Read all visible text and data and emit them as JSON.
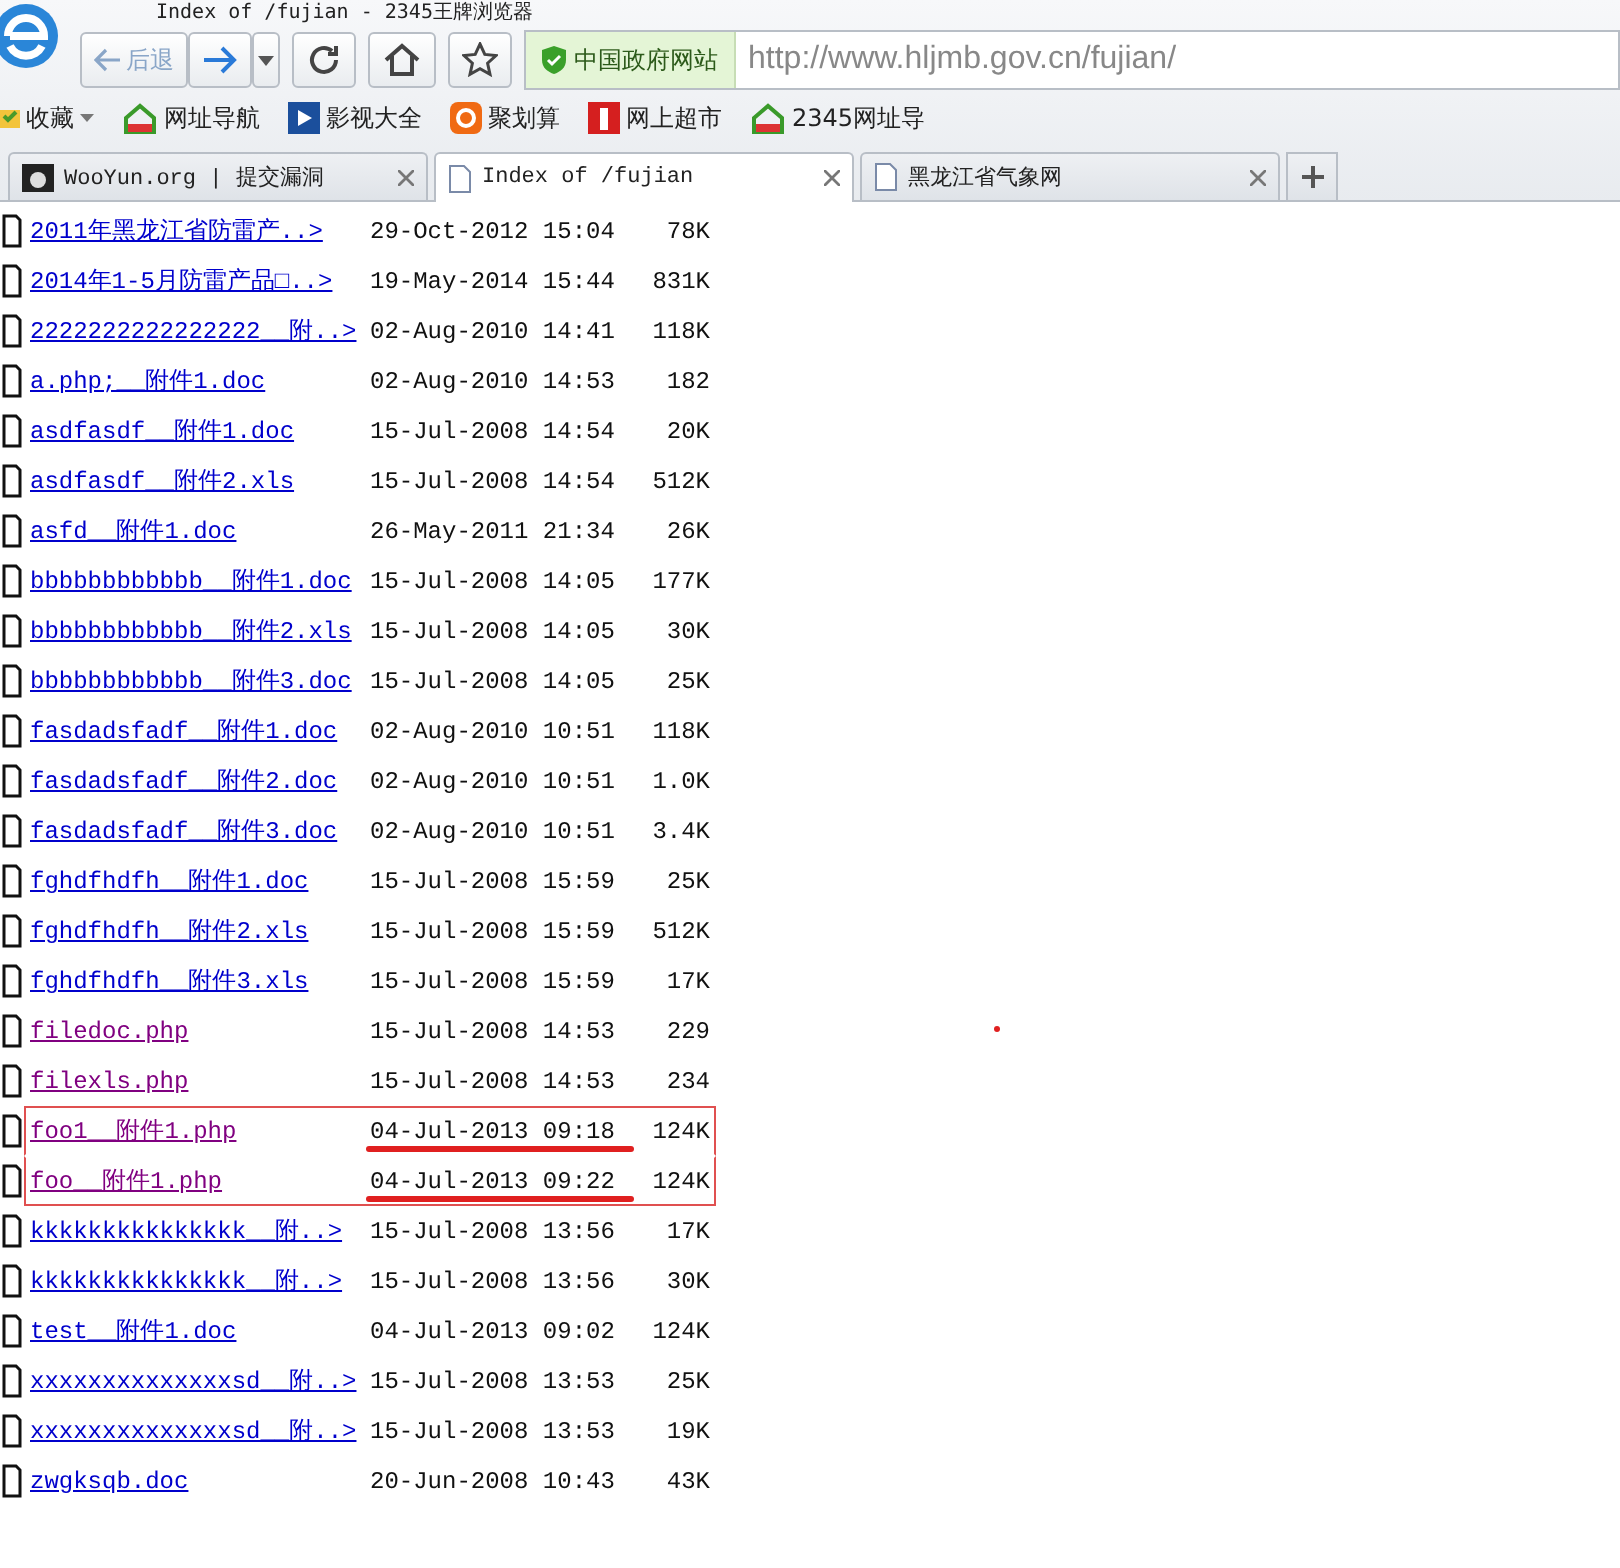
{
  "window": {
    "title": "Index of /fujian - 2345王牌浏览器"
  },
  "toolbar": {
    "back_label": "后退",
    "security_badge": "中国政府网站",
    "url": "http://www.hljmb.gov.cn/fujian/"
  },
  "bookmarks": [
    {
      "label": "收藏",
      "kind": "favorites"
    },
    {
      "label": "网址导航",
      "kind": "nav"
    },
    {
      "label": "影视大全",
      "kind": "video"
    },
    {
      "label": "聚划算",
      "kind": "deal"
    },
    {
      "label": "网上超市",
      "kind": "shop"
    },
    {
      "label": "2345网址导",
      "kind": "nav"
    }
  ],
  "tabs": [
    {
      "label": "WooYun.org | 提交漏洞",
      "selected": false,
      "kind": "site"
    },
    {
      "label": "Index of /fujian",
      "selected": true,
      "kind": "page"
    },
    {
      "label": "黑龙江省气象网",
      "selected": false,
      "kind": "page"
    }
  ],
  "listing": [
    {
      "name": "2011年黑龙江省防雷产..>",
      "date": "29-Oct-2012 15:04",
      "size": "78K",
      "visited": false,
      "highlighted": false,
      "underlined": false
    },
    {
      "name": "2014年1-5月防雷产品□..>",
      "date": "19-May-2014 15:44",
      "size": "831K",
      "visited": false,
      "highlighted": false,
      "underlined": false
    },
    {
      "name": "2222222222222222__附..>",
      "date": "02-Aug-2010 14:41",
      "size": "118K",
      "visited": false,
      "highlighted": false,
      "underlined": false
    },
    {
      "name": "a.php;__附件1.doc",
      "date": "02-Aug-2010 14:53",
      "size": "182",
      "visited": false,
      "highlighted": false,
      "underlined": false
    },
    {
      "name": "asdfasdf__附件1.doc",
      "date": "15-Jul-2008 14:54",
      "size": "20K",
      "visited": false,
      "highlighted": false,
      "underlined": false
    },
    {
      "name": "asdfasdf__附件2.xls",
      "date": "15-Jul-2008 14:54",
      "size": "512K",
      "visited": false,
      "highlighted": false,
      "underlined": false
    },
    {
      "name": "asfd__附件1.doc",
      "date": "26-May-2011 21:34",
      "size": "26K",
      "visited": false,
      "highlighted": false,
      "underlined": false
    },
    {
      "name": "bbbbbbbbbbbb__附件1.doc",
      "date": "15-Jul-2008 14:05",
      "size": "177K",
      "visited": false,
      "highlighted": false,
      "underlined": false
    },
    {
      "name": "bbbbbbbbbbbb__附件2.xls",
      "date": "15-Jul-2008 14:05",
      "size": "30K",
      "visited": false,
      "highlighted": false,
      "underlined": false
    },
    {
      "name": "bbbbbbbbbbbb__附件3.doc",
      "date": "15-Jul-2008 14:05",
      "size": "25K",
      "visited": false,
      "highlighted": false,
      "underlined": false
    },
    {
      "name": "fasdadsfadf__附件1.doc",
      "date": "02-Aug-2010 10:51",
      "size": "118K",
      "visited": false,
      "highlighted": false,
      "underlined": false
    },
    {
      "name": "fasdadsfadf__附件2.doc",
      "date": "02-Aug-2010 10:51",
      "size": "1.0K",
      "visited": false,
      "highlighted": false,
      "underlined": false
    },
    {
      "name": "fasdadsfadf__附件3.doc",
      "date": "02-Aug-2010 10:51",
      "size": "3.4K",
      "visited": false,
      "highlighted": false,
      "underlined": false
    },
    {
      "name": "fghdfhdfh__附件1.doc",
      "date": "15-Jul-2008 15:59",
      "size": "25K",
      "visited": false,
      "highlighted": false,
      "underlined": false
    },
    {
      "name": "fghdfhdfh__附件2.xls",
      "date": "15-Jul-2008 15:59",
      "size": "512K",
      "visited": false,
      "highlighted": false,
      "underlined": false
    },
    {
      "name": "fghdfhdfh__附件3.xls",
      "date": "15-Jul-2008 15:59",
      "size": "17K",
      "visited": false,
      "highlighted": false,
      "underlined": false
    },
    {
      "name": "filedoc.php",
      "date": "15-Jul-2008 14:53",
      "size": "229",
      "visited": true,
      "highlighted": false,
      "underlined": false
    },
    {
      "name": "filexls.php",
      "date": "15-Jul-2008 14:53",
      "size": "234",
      "visited": true,
      "highlighted": false,
      "underlined": false
    },
    {
      "name": "foo1__附件1.php",
      "date": "04-Jul-2013 09:18",
      "size": "124K",
      "visited": true,
      "highlighted": true,
      "underlined": true
    },
    {
      "name": "foo__附件1.php",
      "date": "04-Jul-2013 09:22",
      "size": "124K",
      "visited": true,
      "highlighted": true,
      "underlined": true
    },
    {
      "name": "kkkkkkkkkkkkkkk__附..>",
      "date": "15-Jul-2008 13:56",
      "size": "17K",
      "visited": false,
      "highlighted": false,
      "underlined": false
    },
    {
      "name": "kkkkkkkkkkkkkkk__附..>",
      "date": "15-Jul-2008 13:56",
      "size": "30K",
      "visited": false,
      "highlighted": false,
      "underlined": false
    },
    {
      "name": "test__附件1.doc",
      "date": "04-Jul-2013 09:02",
      "size": "124K",
      "visited": false,
      "highlighted": false,
      "underlined": false
    },
    {
      "name": "xxxxxxxxxxxxxxsd__附..>",
      "date": "15-Jul-2008 13:53",
      "size": "25K",
      "visited": false,
      "highlighted": false,
      "underlined": false
    },
    {
      "name": "xxxxxxxxxxxxxxsd__附..>",
      "date": "15-Jul-2008 13:53",
      "size": "19K",
      "visited": false,
      "highlighted": false,
      "underlined": false
    },
    {
      "name": "zwgksqb.doc",
      "date": "20-Jun-2008 10:43",
      "size": "43K",
      "visited": false,
      "highlighted": false,
      "underlined": false
    }
  ]
}
